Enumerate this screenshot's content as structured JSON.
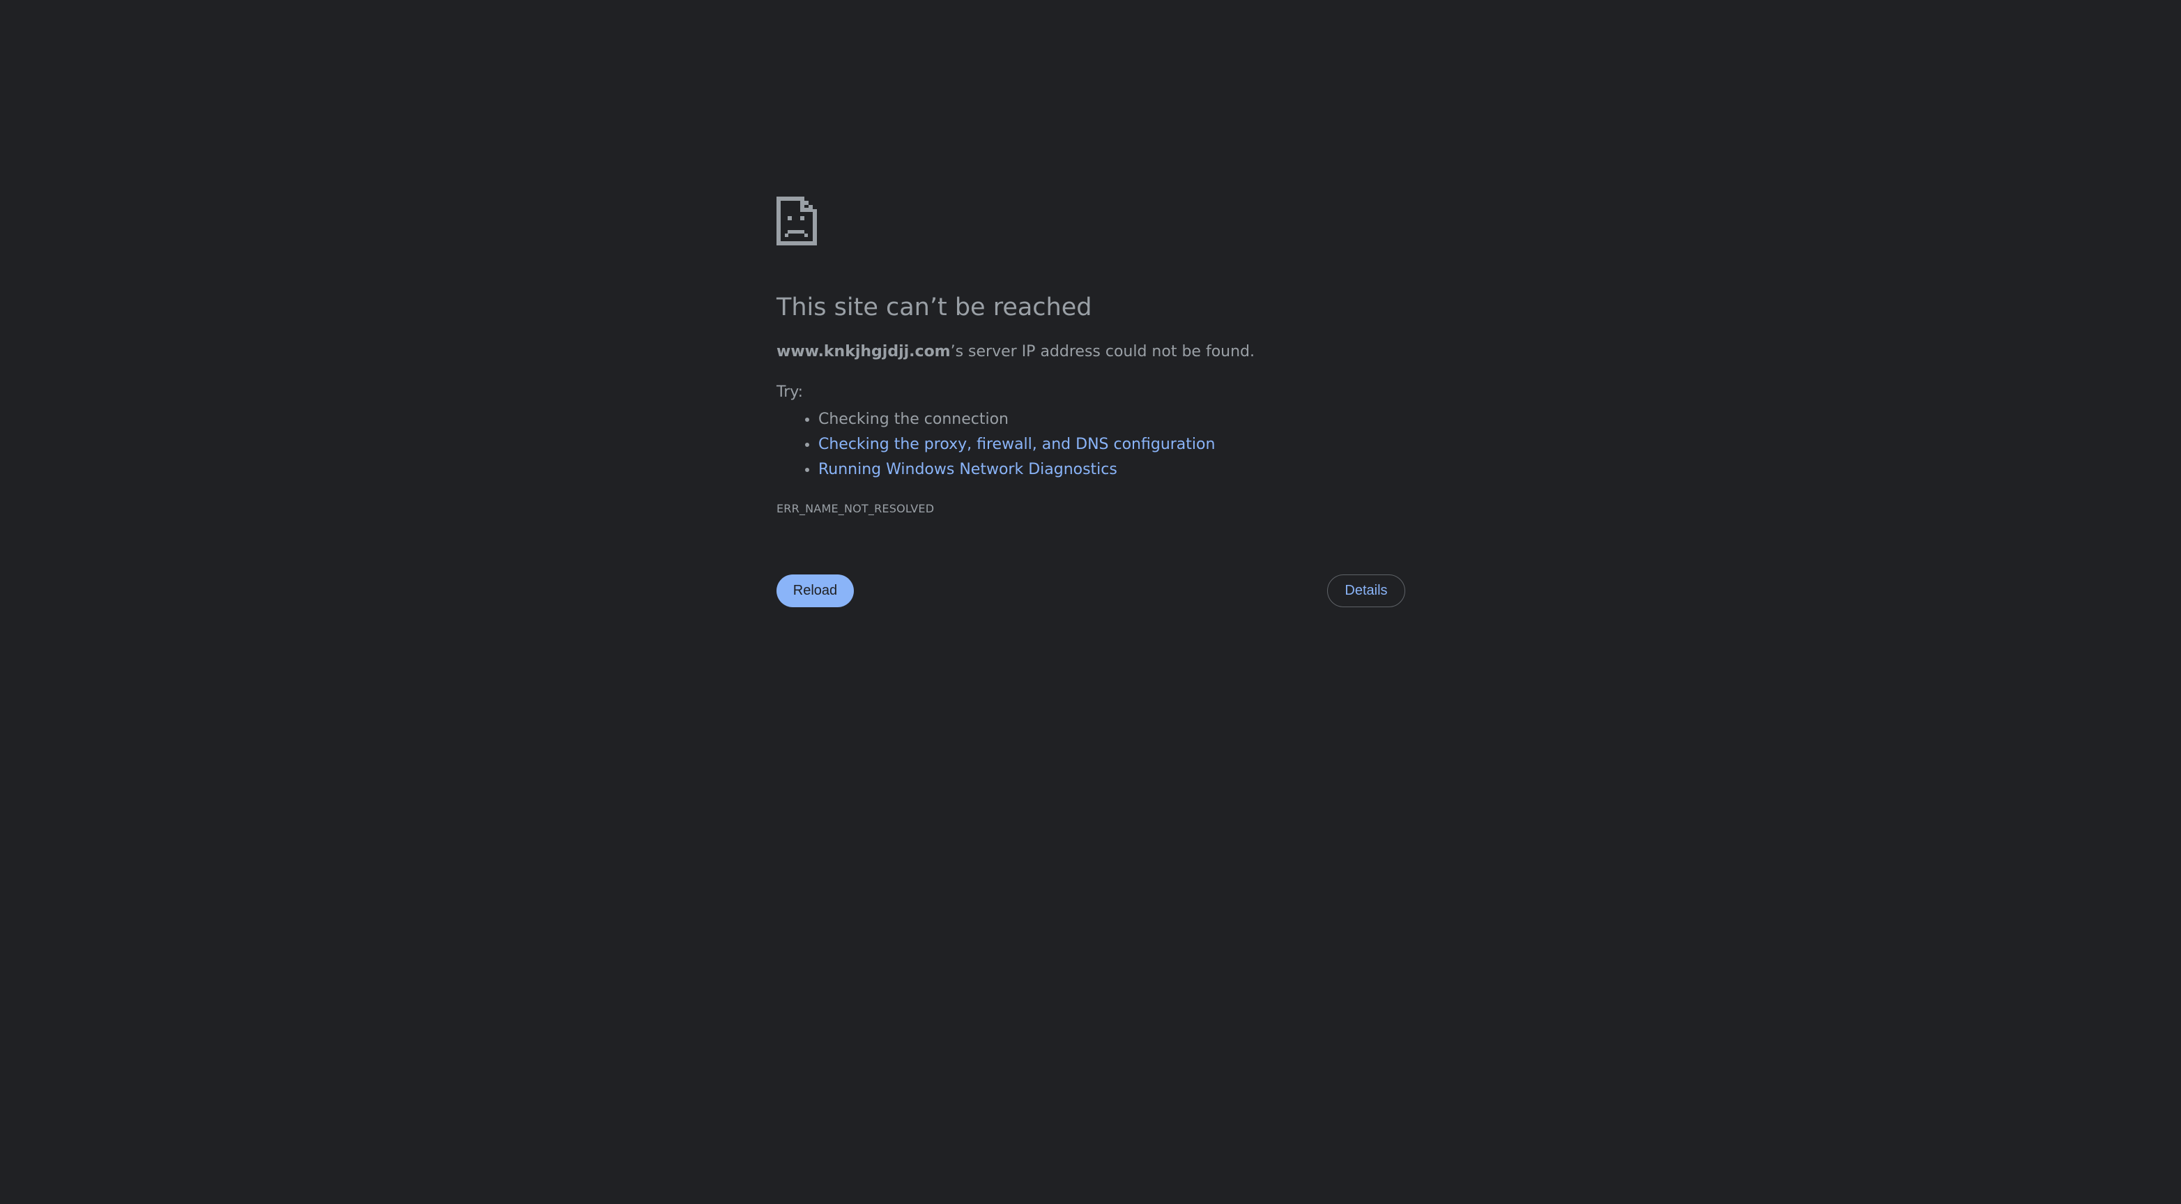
{
  "error_page": {
    "icon": "sad-document-icon",
    "title": "This site can’t be reached",
    "host": "www.knkjhgjdjj.com",
    "message_suffix": "’s server IP address could not be found.",
    "try_label": "Try:",
    "suggestions": [
      {
        "label": "Checking the connection",
        "is_link": false
      },
      {
        "label": "Checking the proxy, firewall, and DNS configuration",
        "is_link": true
      },
      {
        "label": "Running Windows Network Diagnostics",
        "is_link": true
      }
    ],
    "error_code": "ERR_NAME_NOT_RESOLVED",
    "reload_label": "Reload",
    "details_label": "Details"
  },
  "colors": {
    "background": "#202124",
    "text": "#9aa0a6",
    "link": "#8ab4f8",
    "primary_button": "#8ab4f8"
  }
}
